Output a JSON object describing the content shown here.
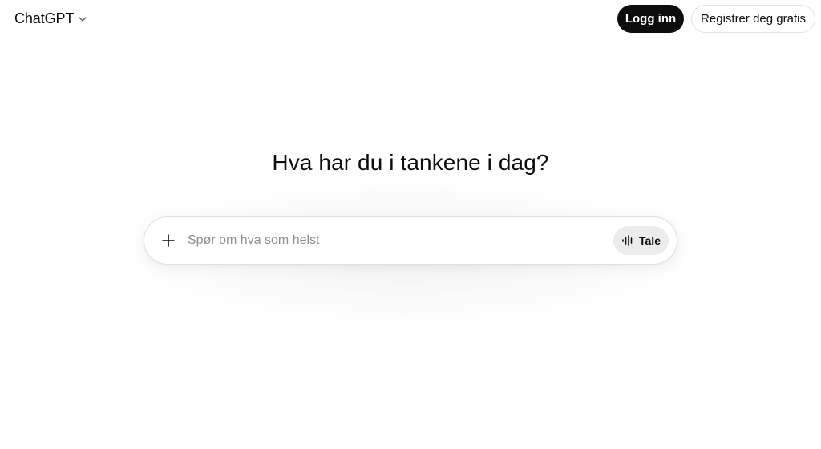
{
  "header": {
    "model_name": "ChatGPT",
    "login_label": "Logg inn",
    "register_label": "Registrer deg gratis"
  },
  "main": {
    "headline": "Hva har du i tankene i dag?",
    "composer": {
      "placeholder": "Spør om hva som helst",
      "value": "",
      "voice_label": "Tale"
    }
  },
  "icons": {
    "model_dropdown": "chevron-down-icon",
    "attach": "plus-icon",
    "voice": "voice-waveform-icon"
  },
  "colors": {
    "background": "#ffffff",
    "text": "#0d0d0d",
    "login_button": "#0d0d0d",
    "voice_button": "#ececec",
    "placeholder": "#8f8f8f"
  }
}
